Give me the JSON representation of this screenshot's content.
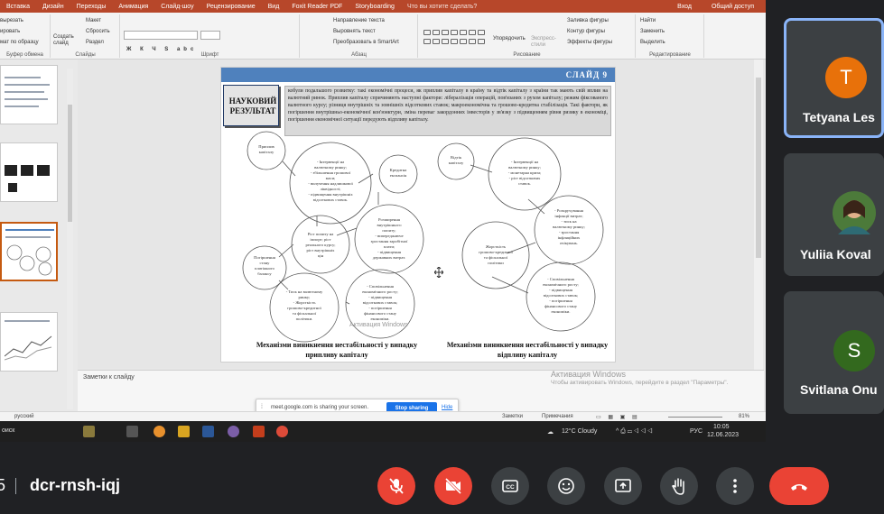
{
  "powerpoint": {
    "ribbon_tabs": [
      "Вставка",
      "Дизайн",
      "Переходы",
      "Анимация",
      "Слайд-шоу",
      "Рецензирование",
      "Вид",
      "Foxit Reader PDF",
      "Storyboarding",
      "Что вы хотите сделать?"
    ],
    "ribbon_right": [
      "Вход",
      "Общий доступ"
    ],
    "ribbon": {
      "clipboard_items": [
        "вырезать",
        "ировать",
        "мат по образцу"
      ],
      "clipboard_group": "Буфер обмена",
      "create_slide": "Создать слайд",
      "slide_items": [
        "Макет",
        "Сбросить",
        "Раздел"
      ],
      "slides_group": "Слайды",
      "font_group": "Шрифт",
      "paragraph_items": [
        "Направление текста",
        "Выровнять текст",
        "Преобразовать в SmartArt"
      ],
      "paragraph_group": "Абзац",
      "arrange": "Упорядочить",
      "express_styles": "Экспресс-стили",
      "drawing_items": [
        "Заливка фигуры",
        "Контур фигуры",
        "Эффекты фигуры"
      ],
      "drawing_group": "Рисование",
      "editing_items": [
        "Найти",
        "Заменить",
        "Выделить"
      ],
      "editing_group": "Редактирование"
    },
    "slide": {
      "number": "СЛАЙД 9",
      "result_box": "НАУКОВИЙ РЕЗУЛЬТАТ",
      "intro_text": "кобули подальшого розвитку: такі економічні процеси, як приплив капіталу в країну та відтік капіталу з країни так мають свій вплив на валютний ринок. Приплив капіталу спричиняють наступні фактори: лібералізація операцій, пов'язаних з рухом капіталу; режим фіксованого валютного курсу; різниця внутрішніх та зовнішніх відсоткових ставок; макроекономічна та грошово-кредитна стабілізація. Такі фактори, як погіршення внутрішньо-економічної кон'юнктури, зміна переваг закордонних інвесторів у зв'язку з підвищенням рівня ризику в економіці, погіршення економічної ситуації передують відпливу капіталу.",
      "left_circles": [
        "Приплив капіталу",
        "- Інтервенції на валютному ринку; - збільшення грошової маси; - вилучення надлишкової ліквідності; - підвищення внутрішніх відсоткових ставок.",
        "Кредитна експансія",
        "Розширення внутрішнього попиту; - випереджаюче зростання заробітної плати; - підвищення державних витрат.",
        "Ріст попиту на імпорт; ріст реального курсу; ріст внутрішніх цін",
        "Погіршення стану платіжного балансу",
        "- Тиск на валютному ринку; - Жорсткість грошово-кредитної та фіскальної політики.",
        "- Сповільнення економічного росту; - підвищення відсоткових ставок; - погіршення фінансового стану економіки."
      ],
      "right_circles": [
        "Відтік капіталу",
        "- Інтервенції на валютному ринку; - монетарна криза; - ріст відсоткових ставок.",
        "- Розкручування інфляції витрат; - тиск на валютному ринку; - зростання інфляційних очікувань.",
        "Жорсткість грошово-кредитної та фіскальної політики",
        "- Сповільнення економічного росту; - підвищення відсоткових ставок; - погіршення фінансового стану економіки."
      ],
      "left_caption": "Механізми виникнення нестабільності у випадку припливу капіталу",
      "right_caption": "Механізми виникнення нестабільності у випадку відпливу капіталу",
      "ghost_activation": "Активация Windows"
    },
    "notes_placeholder": "Заметки к слайду",
    "windows_activation": {
      "title": "Активация Windows",
      "text": "Чтобы активировать Windows, перейдите в раздел \"Параметры\"."
    },
    "status": {
      "language": "русский",
      "notes": "Заметки",
      "comments": "Примечания",
      "zoom": "81%"
    },
    "sharing_bar": {
      "message": "meet.google.com is sharing your screen.",
      "stop": "Stop sharing",
      "hide": "Hide"
    },
    "taskbar": {
      "search": "оиск",
      "weather": "12°C  Cloudy",
      "lang": "РУС",
      "time": "10:05",
      "date": "12.06.2023"
    }
  },
  "participants": [
    {
      "initial": "T",
      "name": "Tetyana Les",
      "color": "#e8710a"
    },
    {
      "initial": "",
      "name": "Yuliia Koval",
      "color": "#5f6368"
    },
    {
      "initial": "S",
      "name": "Svitlana Onu",
      "color": "#33691e"
    }
  ],
  "meeting": {
    "time_fragment": "5",
    "code": "dcr-rnsh-iqj"
  }
}
